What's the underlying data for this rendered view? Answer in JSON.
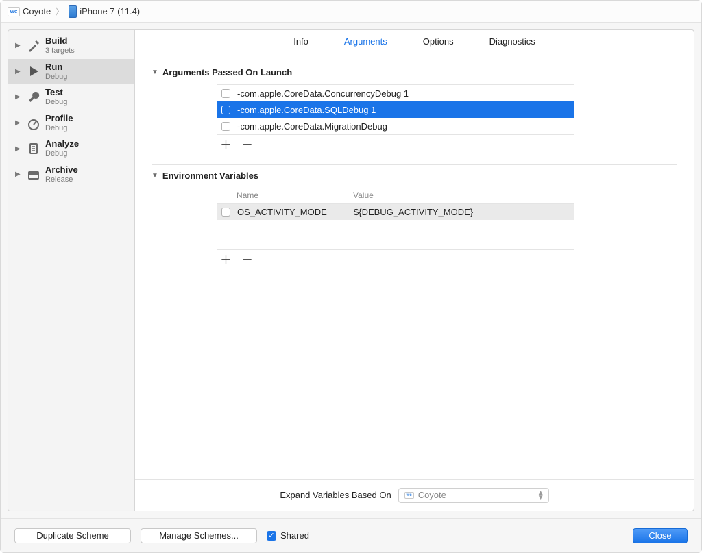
{
  "breadcrumb": {
    "project": "Coyote",
    "device": "iPhone 7 (11.4)"
  },
  "sidebar": {
    "items": [
      {
        "title": "Build",
        "sub": "3 targets"
      },
      {
        "title": "Run",
        "sub": "Debug"
      },
      {
        "title": "Test",
        "sub": "Debug"
      },
      {
        "title": "Profile",
        "sub": "Debug"
      },
      {
        "title": "Analyze",
        "sub": "Debug"
      },
      {
        "title": "Archive",
        "sub": "Release"
      }
    ]
  },
  "tabs": {
    "info": "Info",
    "arguments": "Arguments",
    "options": "Options",
    "diagnostics": "Diagnostics"
  },
  "sections": {
    "args_title": "Arguments Passed On Launch",
    "env_title": "Environment Variables"
  },
  "arguments": [
    {
      "text": "-com.apple.CoreData.ConcurrencyDebug 1"
    },
    {
      "text": "-com.apple.CoreData.SQLDebug 1"
    },
    {
      "text": "-com.apple.CoreData.MigrationDebug"
    }
  ],
  "env": {
    "col_name": "Name",
    "col_value": "Value",
    "rows": [
      {
        "name": "OS_ACTIVITY_MODE",
        "value": "${DEBUG_ACTIVITY_MODE}"
      }
    ]
  },
  "expand": {
    "label": "Expand Variables Based On",
    "value": "Coyote"
  },
  "buttons": {
    "duplicate": "Duplicate Scheme",
    "manage": "Manage Schemes...",
    "shared": "Shared",
    "close": "Close"
  },
  "glyphs": {
    "plus": "＋",
    "minus": "－"
  }
}
